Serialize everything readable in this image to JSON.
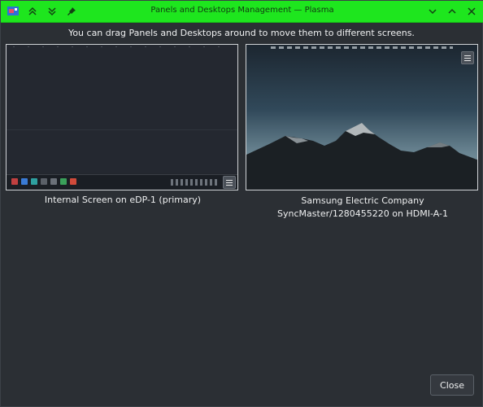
{
  "window": {
    "title": "Panels and Desktops Management — Plasma",
    "accent_color": "#1ee61e"
  },
  "titlebar": {
    "left_icons": [
      "app-icon",
      "keep-above-icon",
      "keep-below-icon",
      "pin-icon"
    ],
    "right_icons": [
      "chevron-down-icon",
      "chevron-up-icon",
      "close-icon"
    ]
  },
  "header": {
    "text": "You can drag Panels and Desktops around to move them to different screens."
  },
  "screens": [
    {
      "label": "Internal Screen on eDP-1 (primary)"
    },
    {
      "label": "Samsung Electric Company SyncMaster/1280455220 on HDMI-A-1"
    }
  ],
  "footer": {
    "close_label": "Close"
  }
}
